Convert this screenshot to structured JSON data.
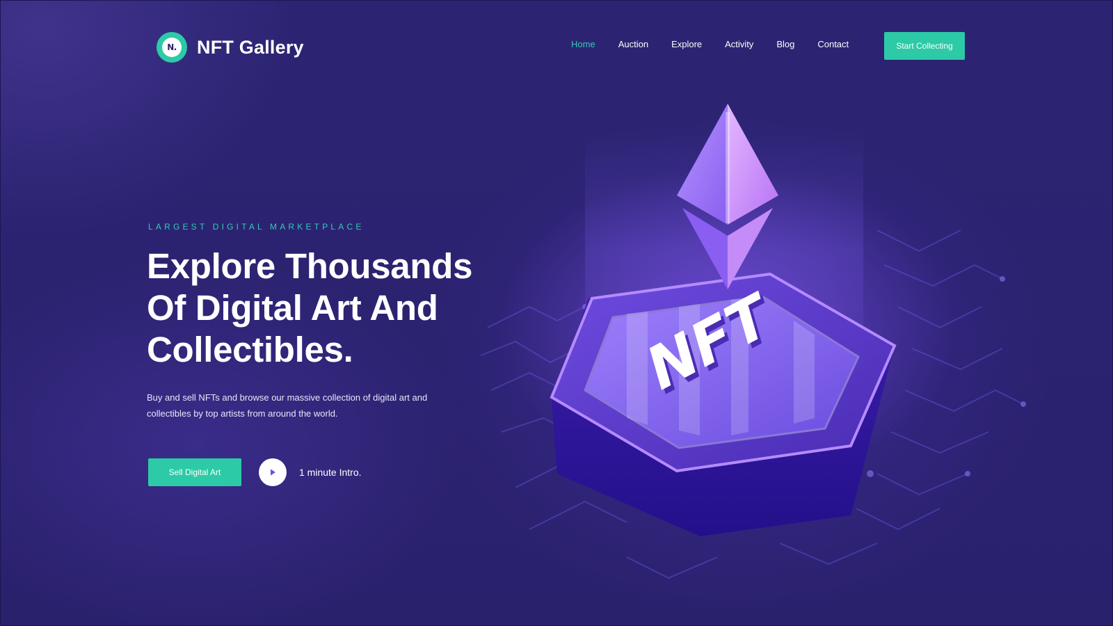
{
  "header": {
    "logo_mark": "N.",
    "logo_text": "NFT Gallery",
    "nav": [
      {
        "label": "Home",
        "active": true
      },
      {
        "label": "Auction",
        "active": false
      },
      {
        "label": "Explore",
        "active": false
      },
      {
        "label": "Activity",
        "active": false
      },
      {
        "label": "Blog",
        "active": false
      },
      {
        "label": "Contact",
        "active": false
      }
    ],
    "cta_label": "Start Collecting"
  },
  "hero": {
    "eyebrow": "LARGEST DIGITAL MARKETPLACE",
    "headline_lines": [
      "Explore Thousands",
      "Of Digital Art And",
      "Collectibles."
    ],
    "description": "Buy and sell NFTs and browse our massive collection of digital art and collectibles by top artists from around the world.",
    "primary_button": "Sell Digital Art",
    "video_label": "1 minute Intro."
  },
  "illustration": {
    "badge_text": "NFT",
    "icons": [
      "ethereum-icon",
      "nft-hexagon-pedestal",
      "circuit-lines"
    ]
  },
  "colors": {
    "background": "#2b2370",
    "accent": "#2ccaa6",
    "accent_text": "#37c9b3",
    "text": "#ffffff"
  }
}
